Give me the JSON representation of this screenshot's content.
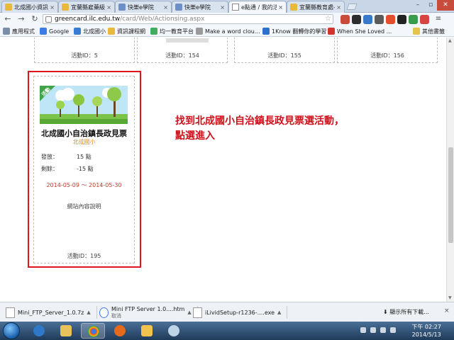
{
  "tabs": [
    {
      "label": "北成國小資訊融",
      "active": false
    },
    {
      "label": "宜蘭縣雇藥級北",
      "active": false
    },
    {
      "label": "快樂e學院",
      "active": false
    },
    {
      "label": "快樂e學院",
      "active": false
    },
    {
      "label": "e點通 / 我的活動",
      "active": true
    },
    {
      "label": "宜蘭縣教育處-創",
      "active": false
    }
  ],
  "toolbar": {
    "url_host": "greencard.ilc.edu.tw",
    "url_path": "/card/Web/Actionsing.aspx"
  },
  "bookmarks": [
    {
      "label": "應用程式",
      "color": "#7a8ea8"
    },
    {
      "label": "Google",
      "color": "#3b7be8"
    },
    {
      "label": "北成國小",
      "color": "#3a7bd5"
    },
    {
      "label": "資訊課程網",
      "color": "#e8b93b"
    },
    {
      "label": "均一教育平台",
      "color": "#3fae5e"
    },
    {
      "label": "Make a word clou...",
      "color": "#9a9a9a"
    },
    {
      "label": "1Know 翻轉你的學習",
      "color": "#2b73c9"
    },
    {
      "label": "When She Loved ...",
      "color": "#d2332f"
    },
    {
      "label": "其他書籤",
      "color": "#e6c34a"
    }
  ],
  "top_cards": [
    {
      "activity_id": "活動ID：5"
    },
    {
      "activity_id": "活動ID：154"
    },
    {
      "activity_id": "活動ID：155"
    },
    {
      "activity_id": "活動ID：156"
    }
  ],
  "featured_card": {
    "ribbon": "活動",
    "title": "北成國小自治鎮長政見票",
    "school": "北成國小",
    "issued_label": "發放：",
    "issued_value": "15 點",
    "remaining_label": "剩餘：",
    "remaining_value": "-15 點",
    "dates": "2014-05-09 ～ 2014-05-30",
    "site_link": "網站內容說明",
    "activity_id": "活動ID：195"
  },
  "annotation": {
    "line1": "找到北成國小自治鎮長政見票選活動，",
    "line2": "點選進入"
  },
  "downloads": [
    {
      "name": "Mini_FTP_Server_1.0.7z",
      "sub": ""
    },
    {
      "name": "Mini FTP Server 1.0....htm",
      "sub": "取消"
    },
    {
      "name": "iLividSetup-r1236-....exe",
      "sub": ""
    }
  ],
  "download_shelf": {
    "show_all": "顯示所有下載..."
  },
  "clock": {
    "time": "下午 02:27",
    "date": "2014/5/13"
  },
  "colors": {
    "highlight": "#e0141e",
    "annotation": "#d0101a",
    "date_text": "#c0392b",
    "school_text": "#e08a1a"
  }
}
